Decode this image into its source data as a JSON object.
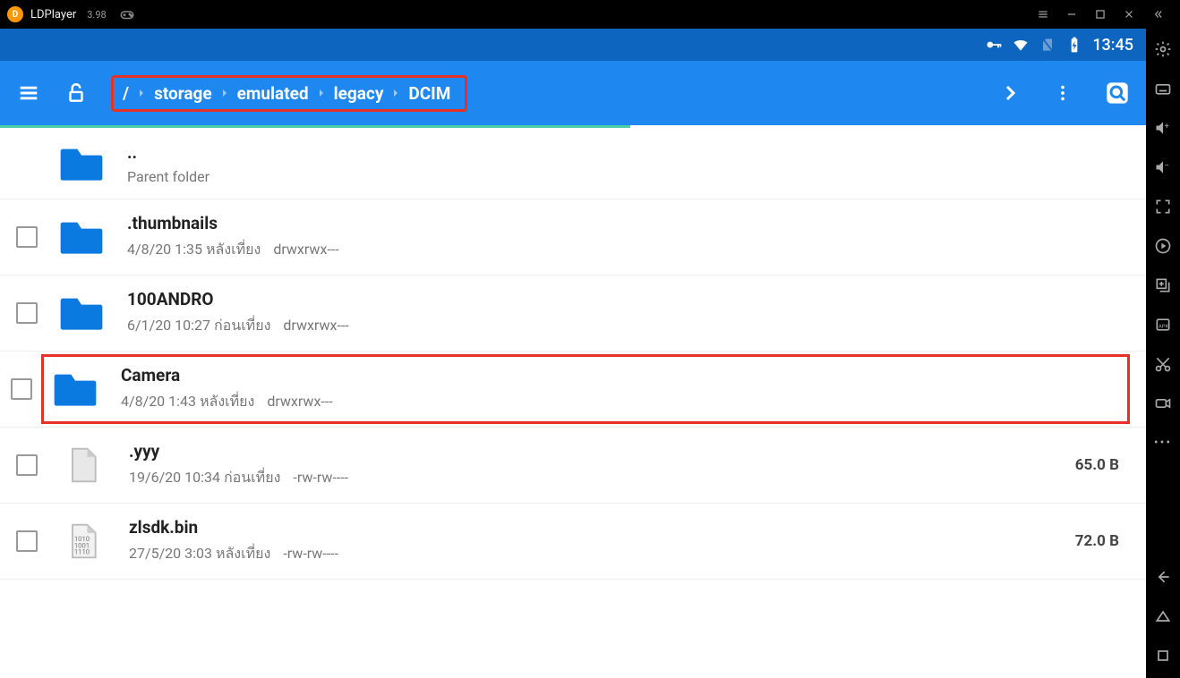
{
  "titlebar": {
    "app_name": "LDPlayer",
    "version": "3.98"
  },
  "status": {
    "time": "13:45"
  },
  "breadcrumb": [
    "/",
    "storage",
    "emulated",
    "legacy",
    "DCIM"
  ],
  "files": [
    {
      "name": "..",
      "sub": "Parent folder",
      "type": "folder",
      "checkbox": false,
      "highlight": false,
      "size": ""
    },
    {
      "name": ".thumbnails",
      "sub": "4/8/20 1:35 หลังเที่ยง",
      "perm": "drwxrwx---",
      "type": "folder",
      "checkbox": true,
      "highlight": false,
      "size": ""
    },
    {
      "name": "100ANDRO",
      "sub": "6/1/20 10:27 ก่อนเที่ยง",
      "perm": "drwxrwx---",
      "type": "folder",
      "checkbox": true,
      "highlight": false,
      "size": ""
    },
    {
      "name": "Camera",
      "sub": "4/8/20 1:43 หลังเที่ยง",
      "perm": "drwxrwx---",
      "type": "folder",
      "checkbox": true,
      "highlight": true,
      "size": ""
    },
    {
      "name": ".yyy",
      "sub": "19/6/20 10:34 ก่อนเที่ยง",
      "perm": "-rw-rw----",
      "type": "file",
      "checkbox": true,
      "highlight": false,
      "size": "65.0 B"
    },
    {
      "name": "zlsdk.bin",
      "sub": "27/5/20 3:03 หลังเที่ยง",
      "perm": "-rw-rw----",
      "type": "binfile",
      "checkbox": true,
      "highlight": false,
      "size": "72.0 B"
    }
  ]
}
